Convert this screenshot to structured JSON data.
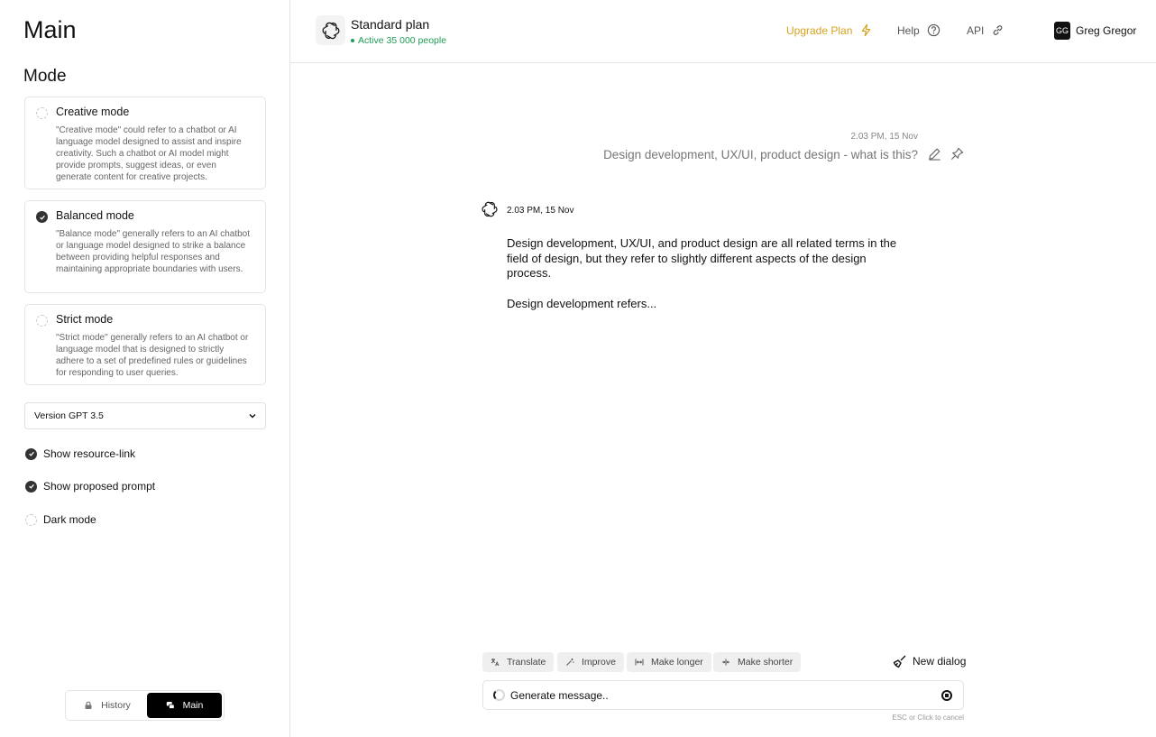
{
  "sidebar": {
    "title": "Main",
    "mode_heading": "Mode",
    "modes": [
      {
        "title": "Creative mode",
        "desc": "\"Creative mode\" could refer to a chatbot or AI language model designed to assist and inspire creativity. Such a chatbot or AI model might provide prompts, suggest ideas, or even generate content for creative projects.",
        "selected": false
      },
      {
        "title": "Balanced mode",
        "desc": "\"Balance mode\" generally refers to an AI chatbot or language model designed to strike a balance between providing helpful responses and maintaining appropriate boundaries with users.",
        "selected": true
      },
      {
        "title": "Strict mode",
        "desc": "\"Strict mode\" generally refers to an AI chatbot or language model that is designed to strictly adhere to a set of predefined rules or guidelines for responding to user queries.",
        "selected": false
      }
    ],
    "version_select": "Version GPT 3.5",
    "options": [
      {
        "label": "Show resource-link",
        "checked": true
      },
      {
        "label": "Show proposed prompt",
        "checked": true
      },
      {
        "label": "Dark mode",
        "checked": false
      }
    ],
    "toggle": {
      "history": "History",
      "main": "Main",
      "active": "main"
    }
  },
  "header": {
    "plan_name": "Standard plan",
    "plan_sub": "Active 35 000 people",
    "upgrade": "Upgrade Plan",
    "help": "Help",
    "api": "API",
    "user_initials": "GG",
    "user_name": "Greg Gregor"
  },
  "chat": {
    "user_time": "2.03 PM, 15 Nov",
    "user_message": "Design development, UX/UI, product design - what is this?",
    "bot_time": "2.03 PM, 15 Nov",
    "bot_p1": "Design development, UX/UI, and product design are all related terms in the field of design, but they refer to slightly different aspects of the design process.",
    "bot_p2": "Design development refers..."
  },
  "composer": {
    "chips": [
      "Translate",
      "Improve",
      "Make longer",
      "Make shorter"
    ],
    "new_dialog": "New dialog",
    "placeholder": "Generate message..",
    "cancel_hint": "ESC or Click to cancel"
  },
  "colors": {
    "accent_upgrade": "#d6a21e",
    "status_green": "#1f9d55",
    "primary": "#000000"
  }
}
